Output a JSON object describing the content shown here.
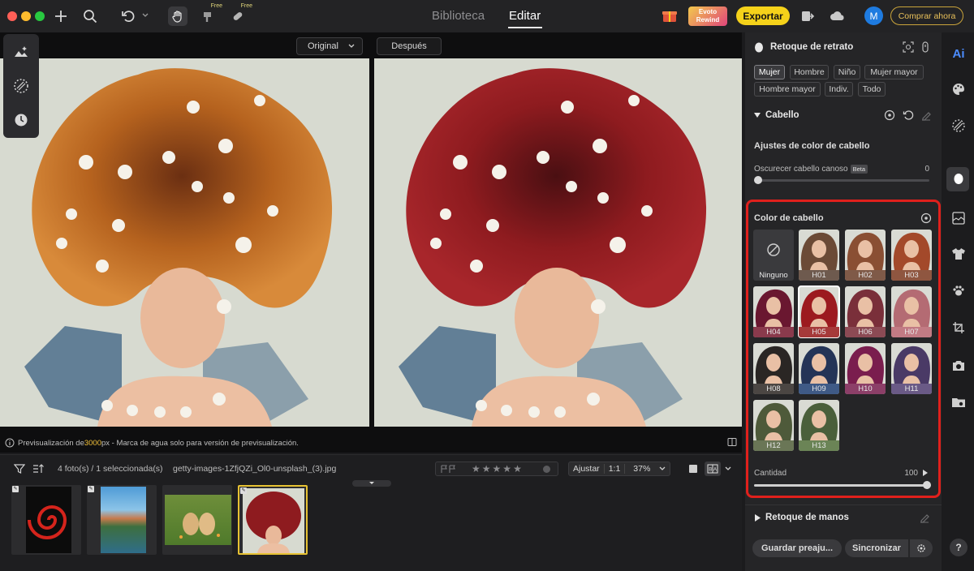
{
  "topbar": {
    "free_badge_1": "Free",
    "free_badge_2": "Free",
    "tab_library": "Biblioteca",
    "tab_edit": "Editar",
    "rewind_line1": "Evoto",
    "rewind_line2": "Rewind",
    "export_label": "Exportar",
    "avatar_initial": "M",
    "buy_label": "Comprar ahora"
  },
  "canvas": {
    "original_select": "Original",
    "after_label": "Después",
    "preview_prefix": "Previsualización de ",
    "preview_size": "3000",
    "preview_suffix": "px - Marca de agua solo para versión de previsualización."
  },
  "filmstrip": {
    "count_label": "4 foto(s) / 1 seleccionada(s)",
    "filename": "getty-images-1ZfjQZi_Ol0-unsplash_(3).jpg",
    "fit_label": "Ajustar",
    "ratio_label": "1:1",
    "zoom_label": "37%",
    "stars": 5
  },
  "panel": {
    "title": "Retoque de retrato",
    "chips": [
      "Mujer",
      "Hombre",
      "Niño",
      "Mujer mayor",
      "Hombre mayor",
      "Indiv.",
      "Todo"
    ],
    "active_chip": "Mujer",
    "section_hair": "Cabello",
    "hair_color_adjust": "Ajustes de color de cabello",
    "gray_hair_label": "Oscurecer cabello canoso",
    "beta_badge": "Beta",
    "gray_hair_value": "0",
    "hair_color_title": "Color de cabello",
    "none_label": "Ninguno",
    "swatches": [
      {
        "code": "H01",
        "color": "#6b4a36",
        "band": "#6e5a4e"
      },
      {
        "code": "H02",
        "color": "#8a4f33",
        "band": "#7f5a48"
      },
      {
        "code": "H03",
        "color": "#a3492a",
        "band": "#8f5640"
      },
      {
        "code": "H04",
        "color": "#6a1730",
        "band": "#8a3a4c"
      },
      {
        "code": "H05",
        "color": "#9c1a1f",
        "band": "#a63a3a"
      },
      {
        "code": "H06",
        "color": "#7a2f3a",
        "band": "#8c4a54"
      },
      {
        "code": "H07",
        "color": "#b46b73",
        "band": "#c27b84"
      },
      {
        "code": "H08",
        "color": "#2a2624",
        "band": "#4b4643"
      },
      {
        "code": "H09",
        "color": "#243457",
        "band": "#3f5a86"
      },
      {
        "code": "H10",
        "color": "#7a1d4e",
        "band": "#8c3f68"
      },
      {
        "code": "H11",
        "color": "#4a3a66",
        "band": "#6a5a86"
      },
      {
        "code": "H12",
        "color": "#4e5a3a",
        "band": "#6a7656"
      },
      {
        "code": "H13",
        "color": "#4a5f3b",
        "band": "#6b8456"
      }
    ],
    "selected_swatch": "H05",
    "amount_label": "Cantidad",
    "amount_value": "100",
    "amount_fraction": 1.0,
    "gray_fraction": 0.0,
    "hands_section": "Retoque de manos",
    "save_preset": "Guardar preaju...",
    "sync_label": "Sincronizar"
  },
  "colors": {
    "accent_yellow": "#f5d21a",
    "highlight_red": "#e0201c",
    "hair_original": "#b5621e",
    "hair_edited": "#8e1b1f"
  }
}
